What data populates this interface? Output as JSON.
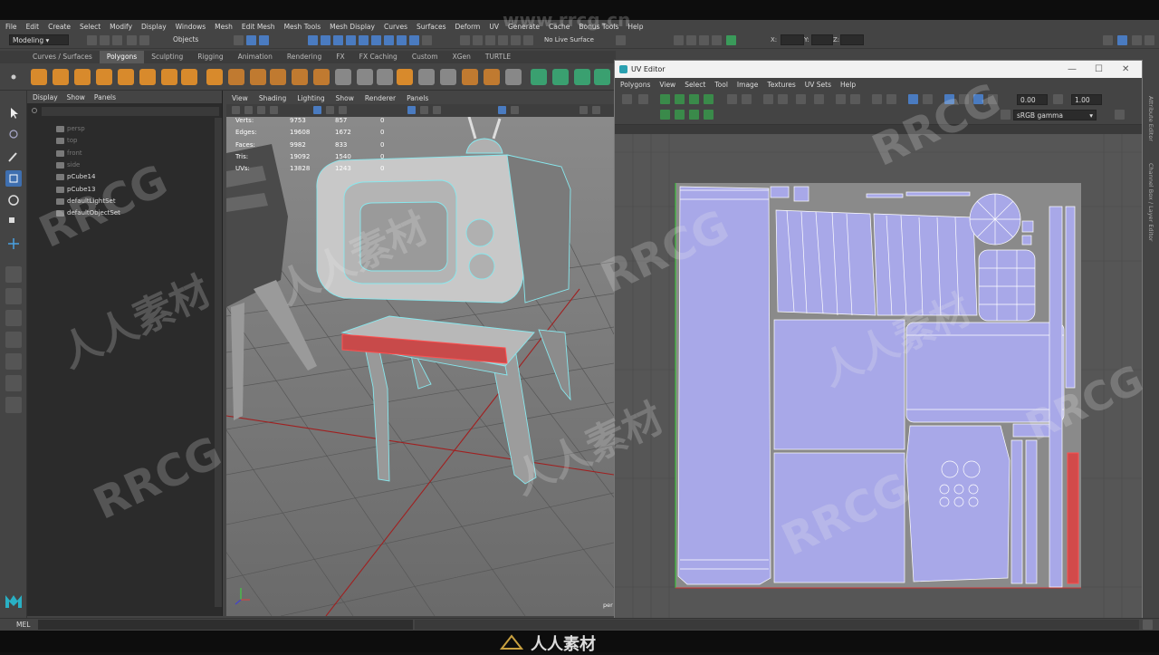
{
  "menubar": [
    "File",
    "Edit",
    "Create",
    "Select",
    "Modify",
    "Display",
    "Windows",
    "Mesh",
    "Edit Mesh",
    "Mesh Tools",
    "Mesh Display",
    "Curves",
    "Surfaces",
    "Deform",
    "UV",
    "Generate",
    "Cache",
    "Bonus Tools",
    "Help"
  ],
  "status": {
    "workspace": "Modeling",
    "objects": "Objects",
    "live_surface": "No Live Surface",
    "x_label": "X:",
    "y_label": "Y:",
    "z_label": "Z:"
  },
  "shelf_tabs": [
    "Curves / Surfaces",
    "Polygons",
    "Sculpting",
    "Rigging",
    "Animation",
    "Rendering",
    "FX",
    "FX Caching",
    "Custom",
    "XGen",
    "TURTLE"
  ],
  "shelf_active": "Polygons",
  "outliner": {
    "menu": [
      "Display",
      "Show",
      "Panels"
    ],
    "items": [
      {
        "label": "persp",
        "dim": true
      },
      {
        "label": "top",
        "dim": true
      },
      {
        "label": "front",
        "dim": true
      },
      {
        "label": "side",
        "dim": true
      },
      {
        "label": "pCube14",
        "dim": false
      },
      {
        "label": "pCube13",
        "dim": false
      },
      {
        "label": "defaultLightSet",
        "dim": false
      },
      {
        "label": "defaultObjectSet",
        "dim": false
      }
    ]
  },
  "viewport": {
    "menu": [
      "View",
      "Shading",
      "Lighting",
      "Show",
      "Renderer",
      "Panels"
    ],
    "hud": [
      {
        "label": "Verts:",
        "a": "9753",
        "b": "857",
        "c": "0"
      },
      {
        "label": "Edges:",
        "a": "19608",
        "b": "1672",
        "c": "0"
      },
      {
        "label": "Faces:",
        "a": "9982",
        "b": "833",
        "c": "0"
      },
      {
        "label": "Tris:",
        "a": "19092",
        "b": "1540",
        "c": "0"
      },
      {
        "label": "UVs:",
        "a": "13828",
        "b": "1243",
        "c": "0"
      }
    ],
    "camera_label": "per"
  },
  "uv_editor": {
    "title": "UV Editor",
    "menu": [
      "Polygons",
      "View",
      "Select",
      "Tool",
      "Image",
      "Textures",
      "UV Sets",
      "Help"
    ],
    "value1": "0.00",
    "value2": "1.00",
    "colorspace": "sRGB gamma"
  },
  "right_tabs": [
    "Attribute Editor",
    "Channel Box / Layer Editor"
  ],
  "command_line": "MEL",
  "watermarks": {
    "site": "www.rrcg.cn",
    "brand": "RRCG",
    "cn": "人人素材"
  },
  "colors": {
    "uv_shell": "#a8a8e8",
    "wire": "#88e8ee",
    "selected": "#d84040",
    "grid_red": "#a02020"
  }
}
